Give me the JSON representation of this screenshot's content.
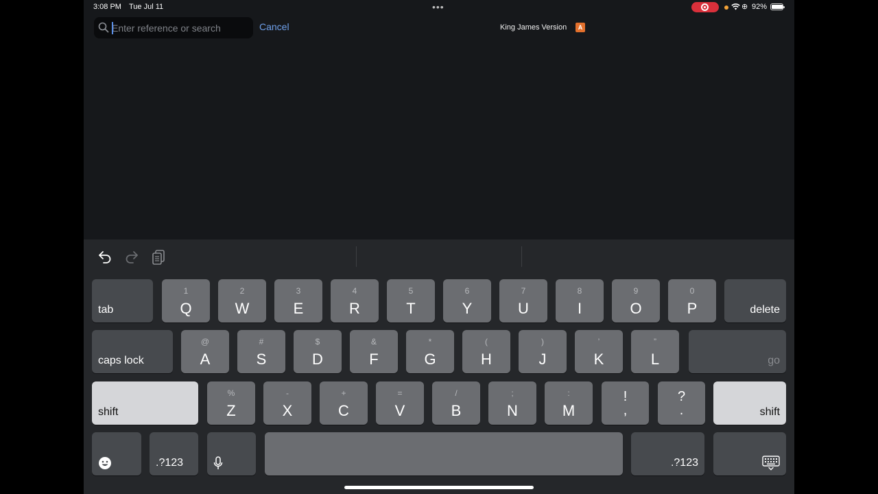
{
  "status_bar": {
    "time": "3:08 PM",
    "date": "Tue Jul 11",
    "dots": "•••",
    "battery": "92%",
    "battery_level": 0.92
  },
  "search": {
    "placeholder": "Enter reference or search",
    "value": "",
    "cancel_label": "Cancel"
  },
  "version": {
    "label": "King James Version",
    "badge": "A",
    "badge_color": "#e3702c"
  },
  "keyboard": {
    "toolbar": [
      "undo-icon",
      "redo-icon",
      "paste-icon"
    ],
    "row1": {
      "tab": "tab",
      "keys": [
        {
          "main": "Q",
          "alt": "1"
        },
        {
          "main": "W",
          "alt": "2"
        },
        {
          "main": "E",
          "alt": "3"
        },
        {
          "main": "R",
          "alt": "4"
        },
        {
          "main": "T",
          "alt": "5"
        },
        {
          "main": "Y",
          "alt": "6"
        },
        {
          "main": "U",
          "alt": "7"
        },
        {
          "main": "I",
          "alt": "8"
        },
        {
          "main": "O",
          "alt": "9"
        },
        {
          "main": "P",
          "alt": "0"
        }
      ],
      "delete": "delete"
    },
    "row2": {
      "caps": "caps lock",
      "keys": [
        {
          "main": "A",
          "alt": "@"
        },
        {
          "main": "S",
          "alt": "#"
        },
        {
          "main": "D",
          "alt": "$"
        },
        {
          "main": "F",
          "alt": "&"
        },
        {
          "main": "G",
          "alt": "*"
        },
        {
          "main": "H",
          "alt": "("
        },
        {
          "main": "J",
          "alt": ")"
        },
        {
          "main": "K",
          "alt": "’"
        },
        {
          "main": "L",
          "alt": "”"
        }
      ],
      "go": "go"
    },
    "row3": {
      "shift_left": "shift",
      "keys": [
        {
          "main": "Z",
          "alt": "%"
        },
        {
          "main": "X",
          "alt": "-"
        },
        {
          "main": "C",
          "alt": "+"
        },
        {
          "main": "V",
          "alt": "="
        },
        {
          "main": "B",
          "alt": "/"
        },
        {
          "main": "N",
          "alt": ";"
        },
        {
          "main": "M",
          "alt": ":"
        }
      ],
      "punct": [
        {
          "top": "!",
          "bottom": ","
        },
        {
          "top": "?",
          "bottom": "."
        }
      ],
      "shift_right": "shift"
    },
    "row4": {
      "emoji": "emoji-icon",
      "numbers_left": ".?123",
      "mic": "microphone-icon",
      "numbers_right": ".?123",
      "dismiss": "keyboard-dismiss-icon"
    }
  },
  "colors": {
    "background": "#16181b",
    "keyboard": "#25272a",
    "key": "#6b6d71",
    "key_special": "#474a4e",
    "accent": "#6fa0ea",
    "recording": "#d9303b"
  }
}
